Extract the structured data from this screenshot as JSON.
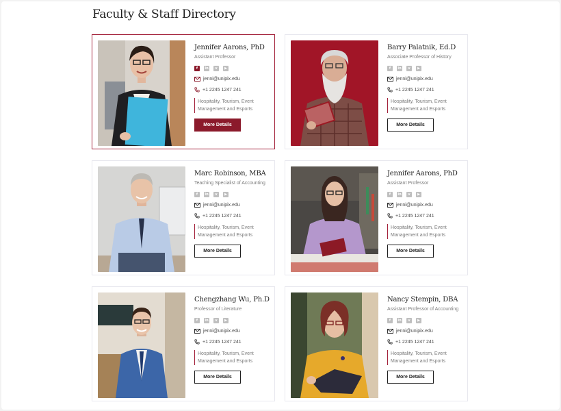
{
  "page": {
    "title": "Faculty & Staff Directory"
  },
  "colors": {
    "accent": "#8b1a2b",
    "icon_gray": "#bfbfbf"
  },
  "social_icons": [
    "facebook-icon",
    "linkedin-icon",
    "vimeo-icon",
    "youtube-icon"
  ],
  "faculty": [
    {
      "name": "Jennifer Aarons, PhD",
      "role": "Assistant Professor",
      "email": "jenni@unipix.edu",
      "phone": "+1 2245 1247 241",
      "dept": "Hospitality, Tourism, Event Management and Esports",
      "button": "More Details"
    },
    {
      "name": "Barry Palatnik, Ed.D",
      "role": "Associate Professor of History",
      "email": "jenni@unipix.edu",
      "phone": "+1 2245 1247 241",
      "dept": "Hospitality, Tourism, Event Management and Esports",
      "button": "More Details"
    },
    {
      "name": "Marc Robinson, MBA",
      "role": "Teaching Specialist of Accounting",
      "email": "jenni@unipix.edu",
      "phone": "+1 2245 1247 241",
      "dept": "Hospitality, Tourism, Event Management and Esports",
      "button": "More Details"
    },
    {
      "name": "Jennifer Aarons, PhD",
      "role": "Assistant Professor",
      "email": "jenni@unipix.edu",
      "phone": "+1 2245 1247 241",
      "dept": "Hospitality, Tourism, Event Management and Esports",
      "button": "More Details"
    },
    {
      "name": "Chengzhang Wu, Ph.D",
      "role": "Professor of Literature",
      "email": "jenni@unipix.edu",
      "phone": "+1 2245 1247 241",
      "dept": "Hospitality, Tourism, Event Management and Esports",
      "button": "More Details"
    },
    {
      "name": "Nancy Stempin, DBA",
      "role": "Assistant Professor of Accounting",
      "email": "jenni@unipix.edu",
      "phone": "+1 2245 1247 241",
      "dept": "Hospitality, Tourism, Event Management and Esports",
      "button": "More Details"
    }
  ]
}
